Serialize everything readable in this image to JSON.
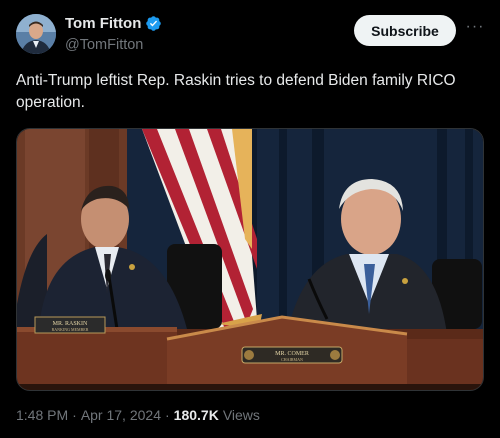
{
  "author": {
    "display_name": "Tom Fitton",
    "handle": "@TomFitton"
  },
  "actions": {
    "subscribe_label": "Subscribe",
    "more_label": "···"
  },
  "post": {
    "text": "Anti-Trump leftist Rep. Raskin tries to defend Biden family RICO operation."
  },
  "media": {
    "nameplate_left": "MR. RASKIN",
    "nameplate_left_sub": "RANKING MEMBER",
    "nameplate_right": "MR. COMER",
    "nameplate_right_sub": "CHAIRMAN"
  },
  "meta": {
    "time": "1:48 PM",
    "separator": "·",
    "date": "Apr 17, 2024",
    "views_count": "180.7K",
    "views_label": "Views"
  },
  "colors": {
    "background": "#000000",
    "text_primary": "#e7e9ea",
    "text_secondary": "#71767b",
    "verified_blue": "#1d9bf0",
    "button_bg": "#eff3f4"
  },
  "icons": {
    "verified": "verified-badge-icon",
    "more": "more-dots-icon"
  }
}
